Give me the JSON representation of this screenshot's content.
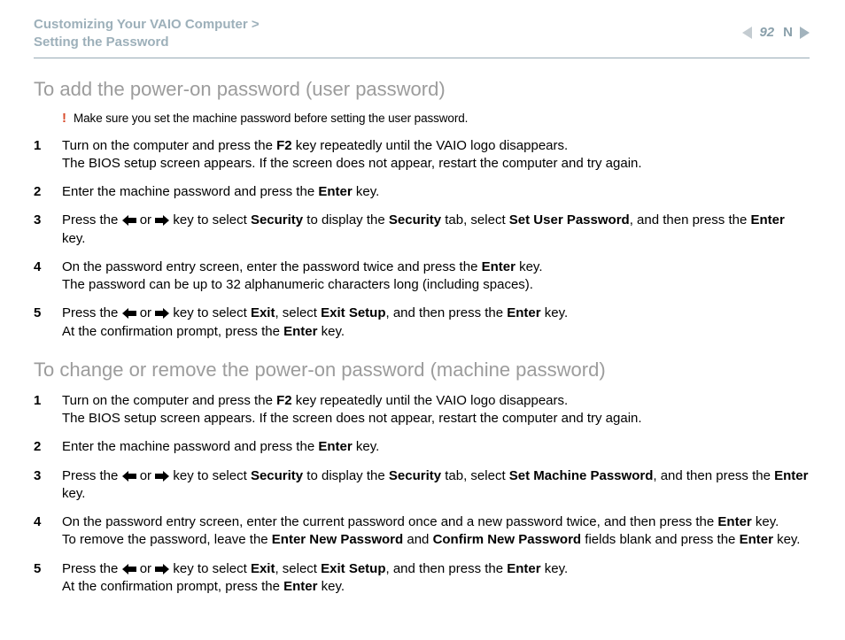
{
  "header": {
    "breadcrumb_line1": "Customizing Your VAIO Computer",
    "breadcrumb_sep": ">",
    "breadcrumb_line2": "Setting the Password",
    "page_number": "92",
    "n_mark": "N"
  },
  "section1": {
    "title": "To add the power-on password (user password)",
    "warning": "Make sure you set the machine password before setting the user password.",
    "steps": [
      {
        "n": "1",
        "parts": [
          "Turn on the computer and press the ",
          [
            "b",
            "F2"
          ],
          " key repeatedly until the VAIO logo disappears.",
          [
            "br"
          ],
          "The BIOS setup screen appears. If the screen does not appear, restart the computer and try again."
        ]
      },
      {
        "n": "2",
        "parts": [
          "Enter the machine password and press the ",
          [
            "b",
            "Enter"
          ],
          " key."
        ]
      },
      {
        "n": "3",
        "parts": [
          "Press the ",
          [
            "la"
          ],
          " or ",
          [
            "ra"
          ],
          " key to select ",
          [
            "b",
            "Security"
          ],
          " to display the ",
          [
            "b",
            "Security"
          ],
          " tab, select ",
          [
            "b",
            "Set User Password"
          ],
          ", and then press the ",
          [
            "b",
            "Enter"
          ],
          " key."
        ]
      },
      {
        "n": "4",
        "parts": [
          "On the password entry screen, enter the password twice and press the ",
          [
            "b",
            "Enter"
          ],
          " key.",
          [
            "br"
          ],
          "The password can be up to 32 alphanumeric characters long (including spaces)."
        ]
      },
      {
        "n": "5",
        "parts": [
          "Press the ",
          [
            "la"
          ],
          " or ",
          [
            "ra"
          ],
          " key to select ",
          [
            "b",
            "Exit"
          ],
          ", select ",
          [
            "b",
            "Exit Setup"
          ],
          ", and then press the ",
          [
            "b",
            "Enter"
          ],
          " key.",
          [
            "br"
          ],
          "At the confirmation prompt, press the ",
          [
            "b",
            "Enter"
          ],
          " key."
        ]
      }
    ]
  },
  "section2": {
    "title": "To change or remove the power-on password (machine password)",
    "steps": [
      {
        "n": "1",
        "parts": [
          "Turn on the computer and press the ",
          [
            "b",
            "F2"
          ],
          " key repeatedly until the VAIO logo disappears.",
          [
            "br"
          ],
          "The BIOS setup screen appears. If the screen does not appear, restart the computer and try again."
        ]
      },
      {
        "n": "2",
        "parts": [
          "Enter the machine password and press the ",
          [
            "b",
            "Enter"
          ],
          " key."
        ]
      },
      {
        "n": "3",
        "parts": [
          "Press the ",
          [
            "la"
          ],
          " or ",
          [
            "ra"
          ],
          " key to select ",
          [
            "b",
            "Security"
          ],
          " to display the ",
          [
            "b",
            "Security"
          ],
          " tab, select ",
          [
            "b",
            "Set Machine Password"
          ],
          ", and then press the ",
          [
            "b",
            "Enter"
          ],
          " key."
        ]
      },
      {
        "n": "4",
        "parts": [
          "On the password entry screen, enter the current password once and a new password twice, and then press the ",
          [
            "b",
            "Enter"
          ],
          " key.",
          [
            "br"
          ],
          "To remove the password, leave the ",
          [
            "b",
            "Enter New Password"
          ],
          " and ",
          [
            "b",
            "Confirm New Password"
          ],
          " fields blank and press the ",
          [
            "b",
            "Enter"
          ],
          " key."
        ]
      },
      {
        "n": "5",
        "parts": [
          "Press the ",
          [
            "la"
          ],
          " or ",
          [
            "ra"
          ],
          " key to select ",
          [
            "b",
            "Exit"
          ],
          ", select ",
          [
            "b",
            "Exit Setup"
          ],
          ", and then press the ",
          [
            "b",
            "Enter"
          ],
          " key.",
          [
            "br"
          ],
          "At the confirmation prompt, press the ",
          [
            "b",
            "Enter"
          ],
          " key."
        ]
      }
    ]
  }
}
